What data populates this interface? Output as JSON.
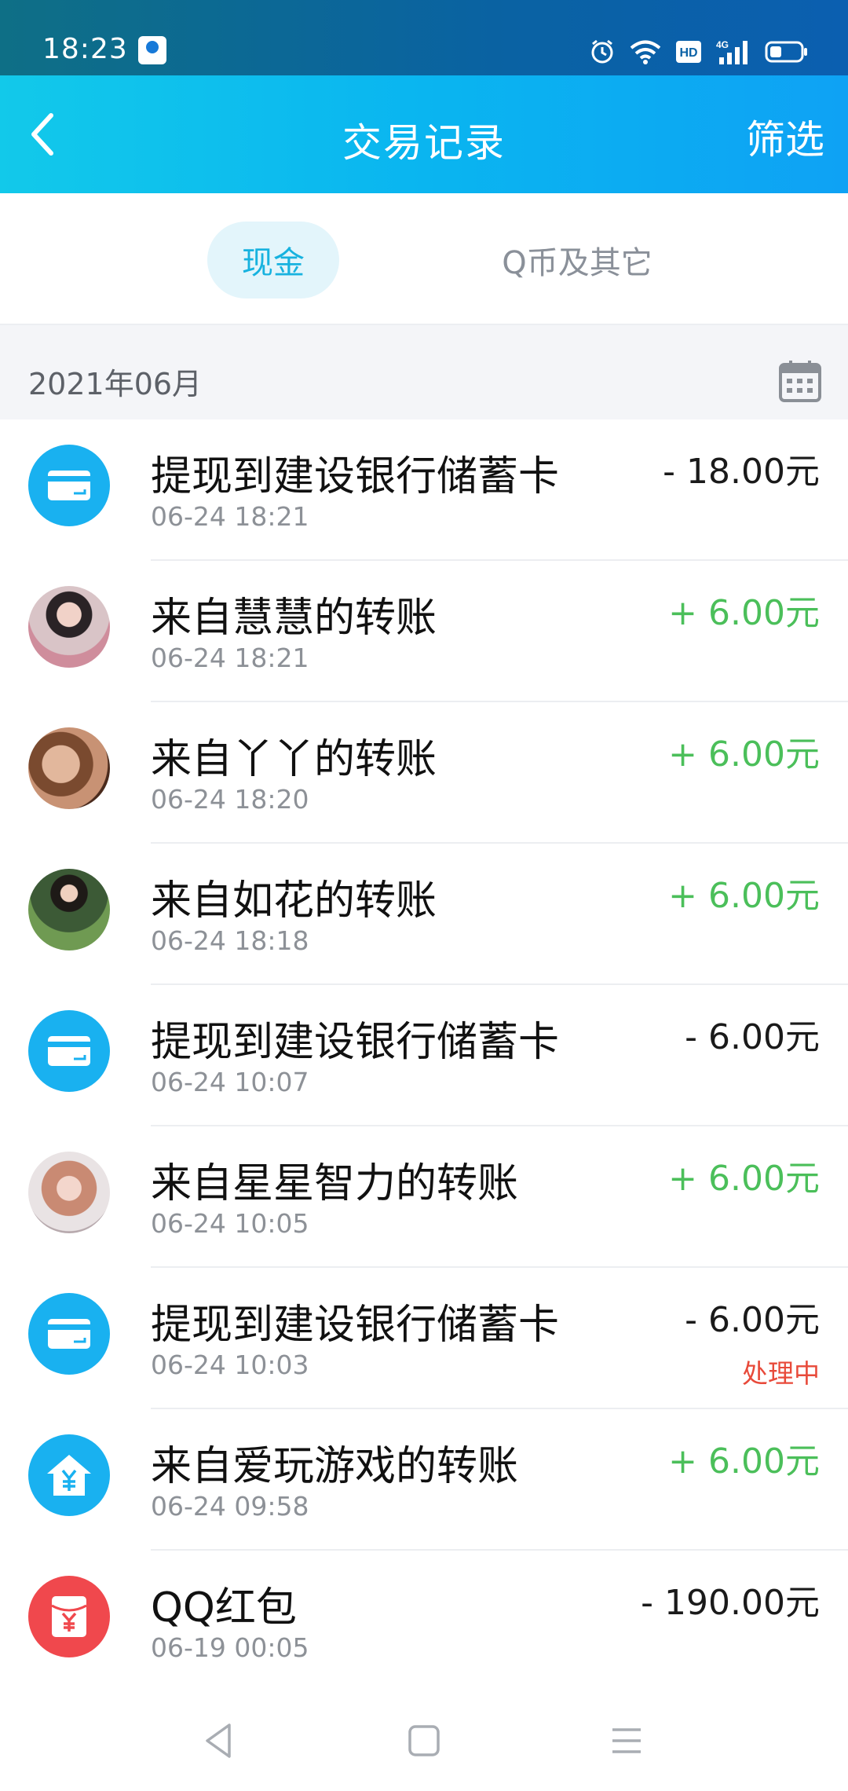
{
  "status": {
    "time": "18:23",
    "icons": [
      "alarm-icon",
      "wifi-icon",
      "hd-icon",
      "signal-4g-icon",
      "battery-icon"
    ],
    "hd": "HD",
    "net": "4G"
  },
  "header": {
    "title": "交易记录",
    "filter_label": "筛选",
    "back_icon": "chevron-left-icon"
  },
  "tabs": [
    {
      "label": "现金",
      "active": true
    },
    {
      "label": "Q币及其它",
      "active": false
    }
  ],
  "month": {
    "label": "2021年06月",
    "icon": "calendar-icon"
  },
  "colors": {
    "accent": "#0ab5f0",
    "positive": "#4bbf5a",
    "negative": "#1a1a1a",
    "processing": "#e84a3a",
    "red_packet": "#f0484d"
  },
  "transactions": [
    {
      "title": "提现到建设银行储蓄卡",
      "time": "06-24 18:21",
      "amount": "- 18.00元",
      "type": "withdraw",
      "icon": "bank-card-icon"
    },
    {
      "title": "来自慧慧的转账",
      "time": "06-24 18:21",
      "amount": "+ 6.00元",
      "type": "transfer-in",
      "icon": "user-avatar"
    },
    {
      "title": "来自丫丫的转账",
      "time": "06-24 18:20",
      "amount": "+ 6.00元",
      "type": "transfer-in",
      "icon": "user-avatar"
    },
    {
      "title": "来自如花的转账",
      "time": "06-24 18:18",
      "amount": "+ 6.00元",
      "type": "transfer-in",
      "icon": "user-avatar"
    },
    {
      "title": "提现到建设银行储蓄卡",
      "time": "06-24 10:07",
      "amount": "- 6.00元",
      "type": "withdraw",
      "icon": "bank-card-icon"
    },
    {
      "title": "来自星星智力的转账",
      "time": "06-24 10:05",
      "amount": "+ 6.00元",
      "type": "transfer-in",
      "icon": "user-avatar"
    },
    {
      "title": "提现到建设银行储蓄卡",
      "time": "06-24 10:03",
      "amount": "- 6.00元",
      "type": "withdraw",
      "icon": "bank-card-icon",
      "status": "处理中"
    },
    {
      "title": "来自爱玩游戏的转账",
      "time": "06-24 09:58",
      "amount": "+ 6.00元",
      "type": "transfer-in",
      "icon": "yuan-house-icon"
    },
    {
      "title": "QQ红包",
      "time": "06-19 00:05",
      "amount": "- 190.00元",
      "type": "red-packet",
      "icon": "red-packet-icon"
    }
  ],
  "nav": [
    "back-triangle-icon",
    "home-square-icon",
    "menu-lines-icon"
  ]
}
